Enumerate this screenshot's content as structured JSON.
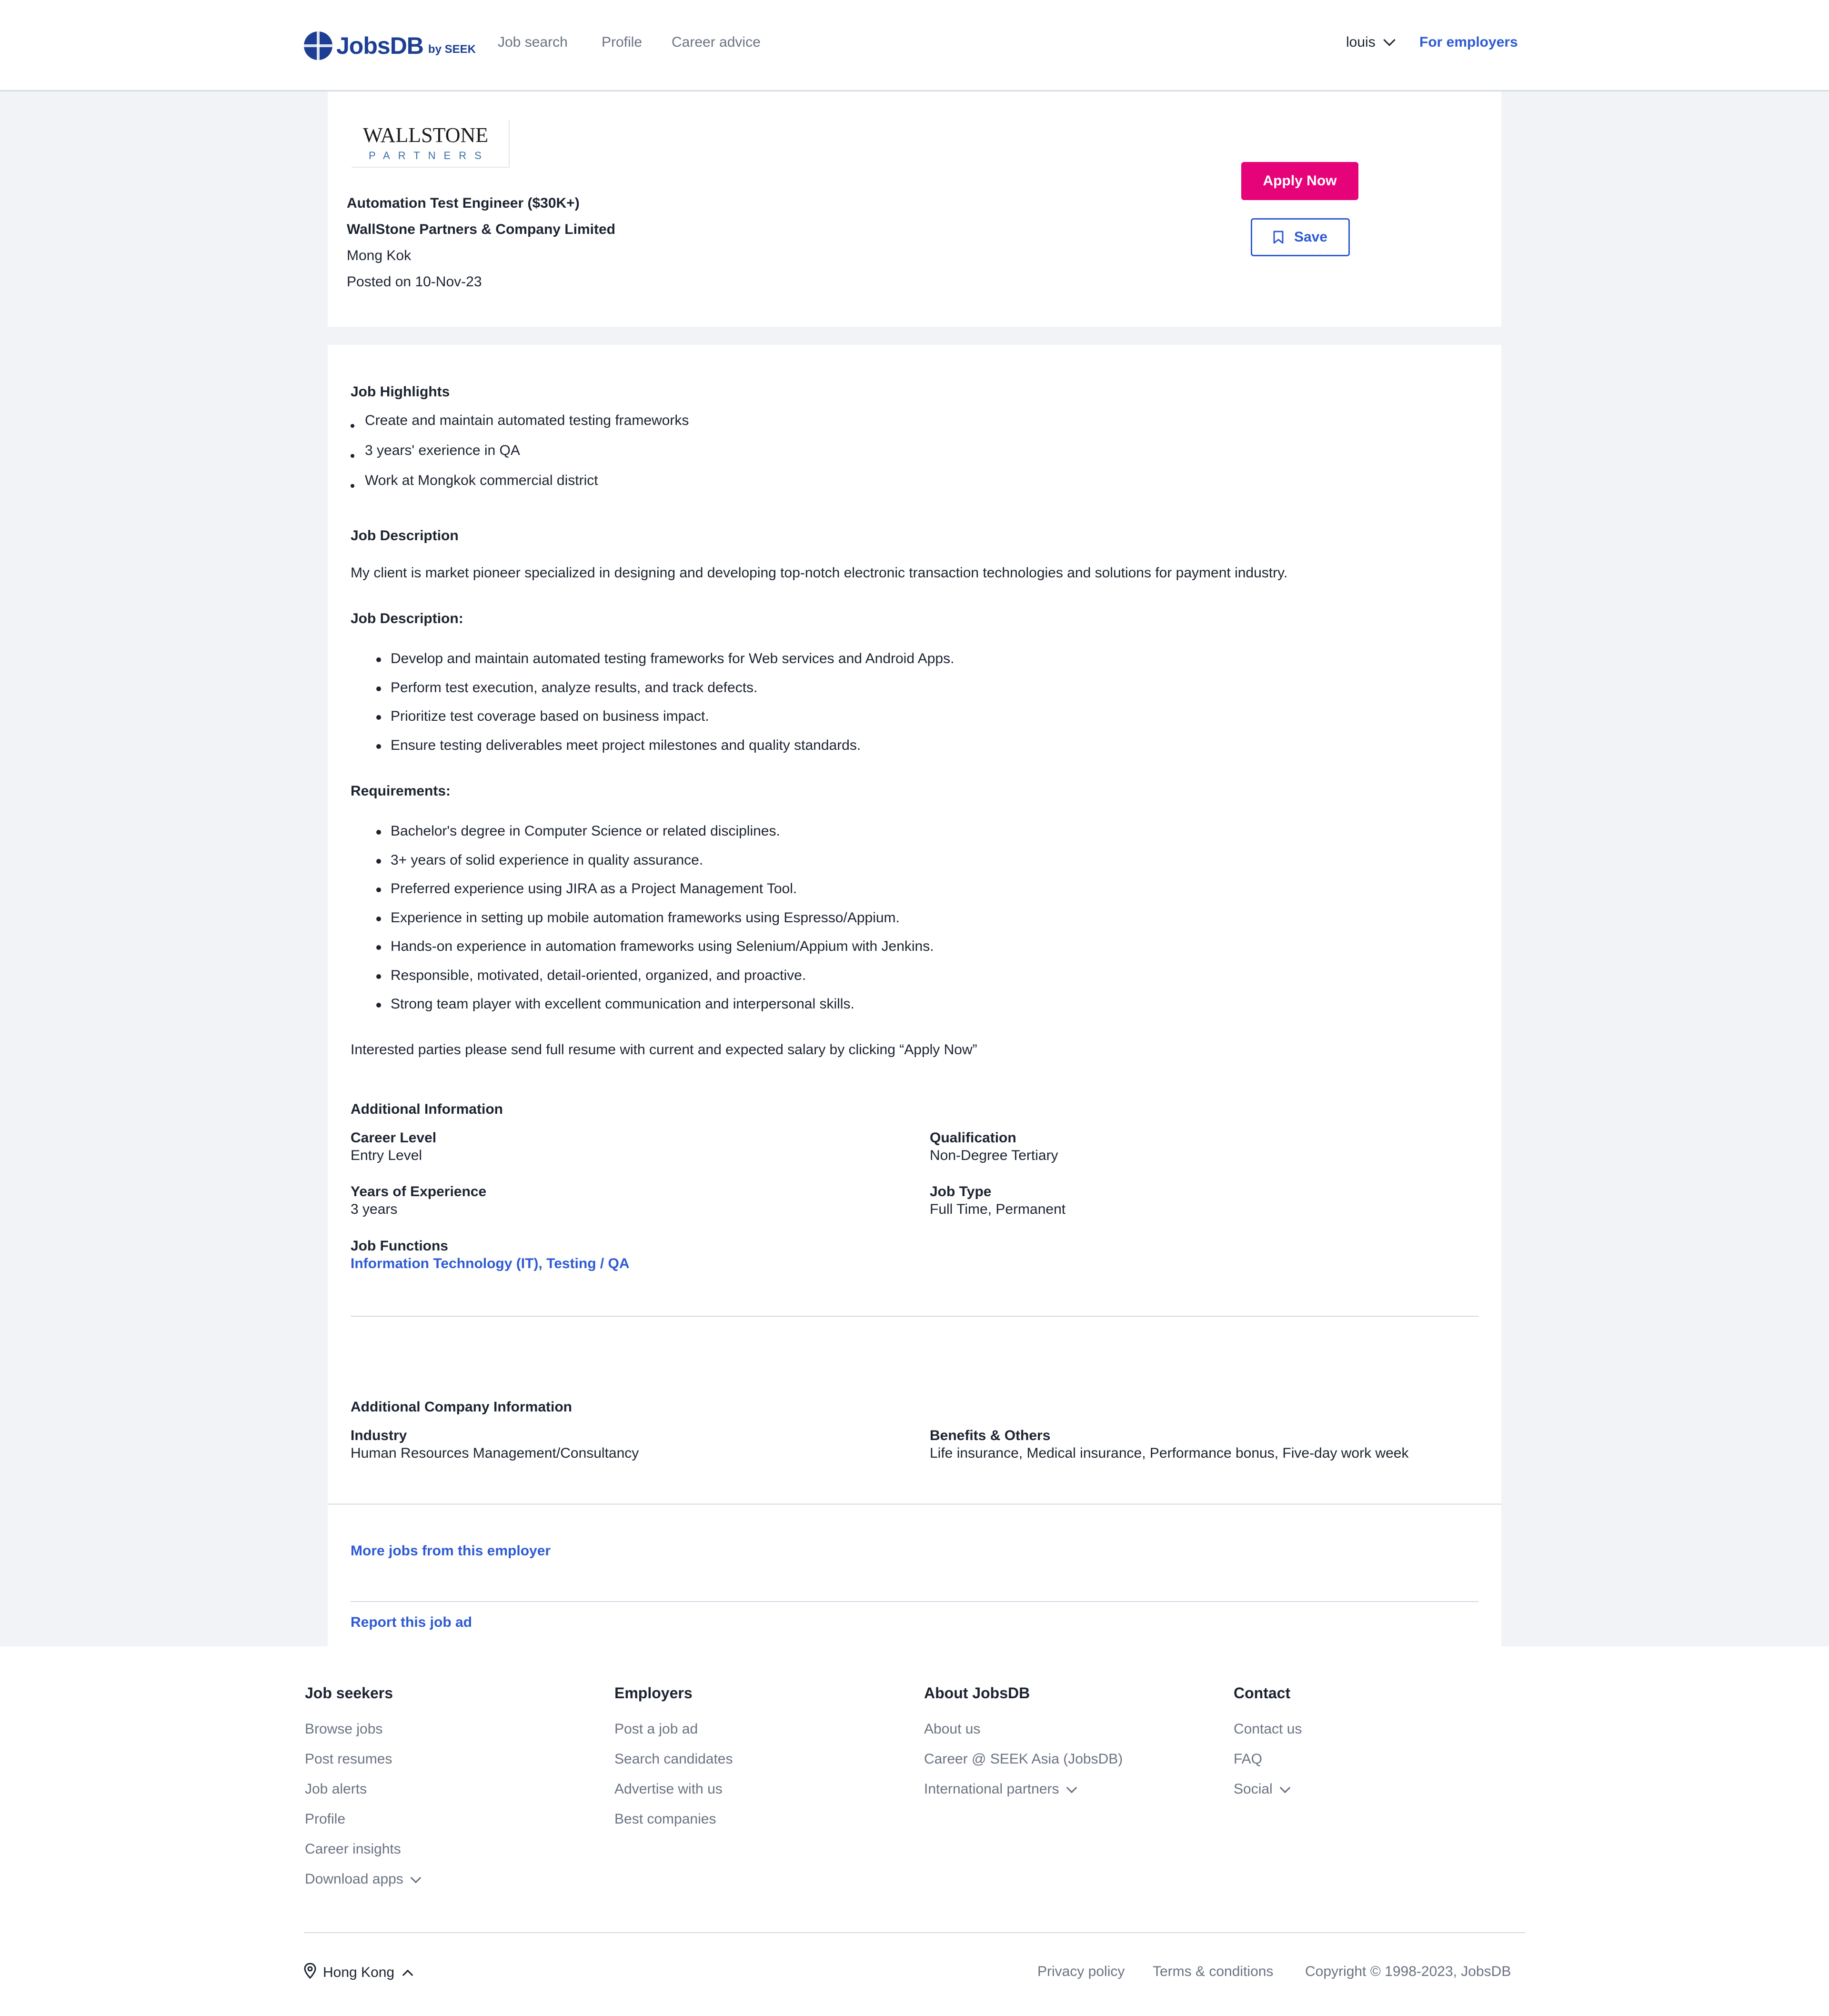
{
  "header": {
    "brand": "JobsDB",
    "brand_sub": "by SEEK",
    "nav": [
      "Job search",
      "Profile",
      "Career advice"
    ],
    "user": "louis",
    "employers_link": "For employers"
  },
  "job": {
    "company_logo_text": "WALLSTONE",
    "company_logo_sub": "PARTNERS",
    "title": "Automation Test Engineer ($30K+)",
    "company": "WallStone Partners & Company Limited",
    "location": "Mong Kok",
    "posted": "Posted on 10-Nov-23",
    "apply_label": "Apply Now",
    "save_label": "Save"
  },
  "highlights": {
    "heading": "Job Highlights",
    "items": [
      "Create and maintain automated testing frameworks",
      "3 years' exerience in QA",
      "Work at Mongkok commercial district"
    ]
  },
  "description": {
    "heading": "Job Description",
    "intro": "My client is market pioneer specialized in designing and developing top-notch electronic transaction technologies and solutions for payment industry.",
    "duties_heading": "Job Description:",
    "duties": [
      "Develop and maintain automated testing frameworks for Web services and Android Apps.",
      "Perform test execution, analyze results, and track defects.",
      "Prioritize test coverage based on business impact.",
      "Ensure testing deliverables meet project milestones and quality standards."
    ],
    "requirements_heading": "Requirements:",
    "requirements": [
      "Bachelor's degree in Computer Science or related disciplines.",
      "3+ years of solid experience in quality assurance.",
      "Preferred experience using JIRA as a Project Management Tool.",
      "Experience in setting up mobile automation frameworks using Espresso/Appium.",
      "Hands-on experience in automation frameworks using Selenium/Appium with Jenkins.",
      "Responsible, motivated, detail-oriented, organized, and proactive.",
      "Strong team player with excellent communication and interpersonal skills."
    ],
    "closing": "Interested parties please send full resume with current and expected salary by clicking “Apply Now”"
  },
  "additional_info": {
    "heading": "Additional Information",
    "career_level_label": "Career Level",
    "career_level": "Entry Level",
    "qualification_label": "Qualification",
    "qualification": "Non-Degree Tertiary",
    "experience_label": "Years of Experience",
    "experience": "3 years",
    "job_type_label": "Job Type",
    "job_type": "Full Time, Permanent",
    "functions_label": "Job Functions",
    "function_1": "Information Technology (IT)",
    "function_sep": ", ",
    "function_2": "Testing / QA"
  },
  "company_info": {
    "heading": "Additional Company Information",
    "industry_label": "Industry",
    "industry": "Human Resources Management/Consultancy",
    "benefits_label": "Benefits & Others",
    "benefits": "Life insurance, Medical insurance, Performance bonus, Five-day work week"
  },
  "links": {
    "more_jobs": "More jobs from this employer",
    "report": "Report this job ad"
  },
  "footer": {
    "job_seekers": {
      "heading": "Job seekers",
      "items": [
        "Browse jobs",
        "Post resumes",
        "Job alerts",
        "Profile",
        "Career insights",
        "Download apps"
      ]
    },
    "employers": {
      "heading": "Employers",
      "items": [
        "Post a job ad",
        "Search candidates",
        "Advertise with us",
        "Best companies"
      ]
    },
    "about": {
      "heading": "About JobsDB",
      "items": [
        "About us",
        "Career @ SEEK Asia (JobsDB)",
        "International partners"
      ]
    },
    "contact": {
      "heading": "Contact",
      "items": [
        "Contact us",
        "FAQ",
        "Social"
      ]
    },
    "region": "Hong Kong",
    "privacy": "Privacy policy",
    "terms": "Terms & conditions",
    "copyright": "Copyright © 1998-2023, JobsDB"
  },
  "colors": {
    "brand": "#1c3f94",
    "link": "#2e5ad3",
    "apply": "#e60278",
    "page_bg": "#f1f3f6"
  }
}
